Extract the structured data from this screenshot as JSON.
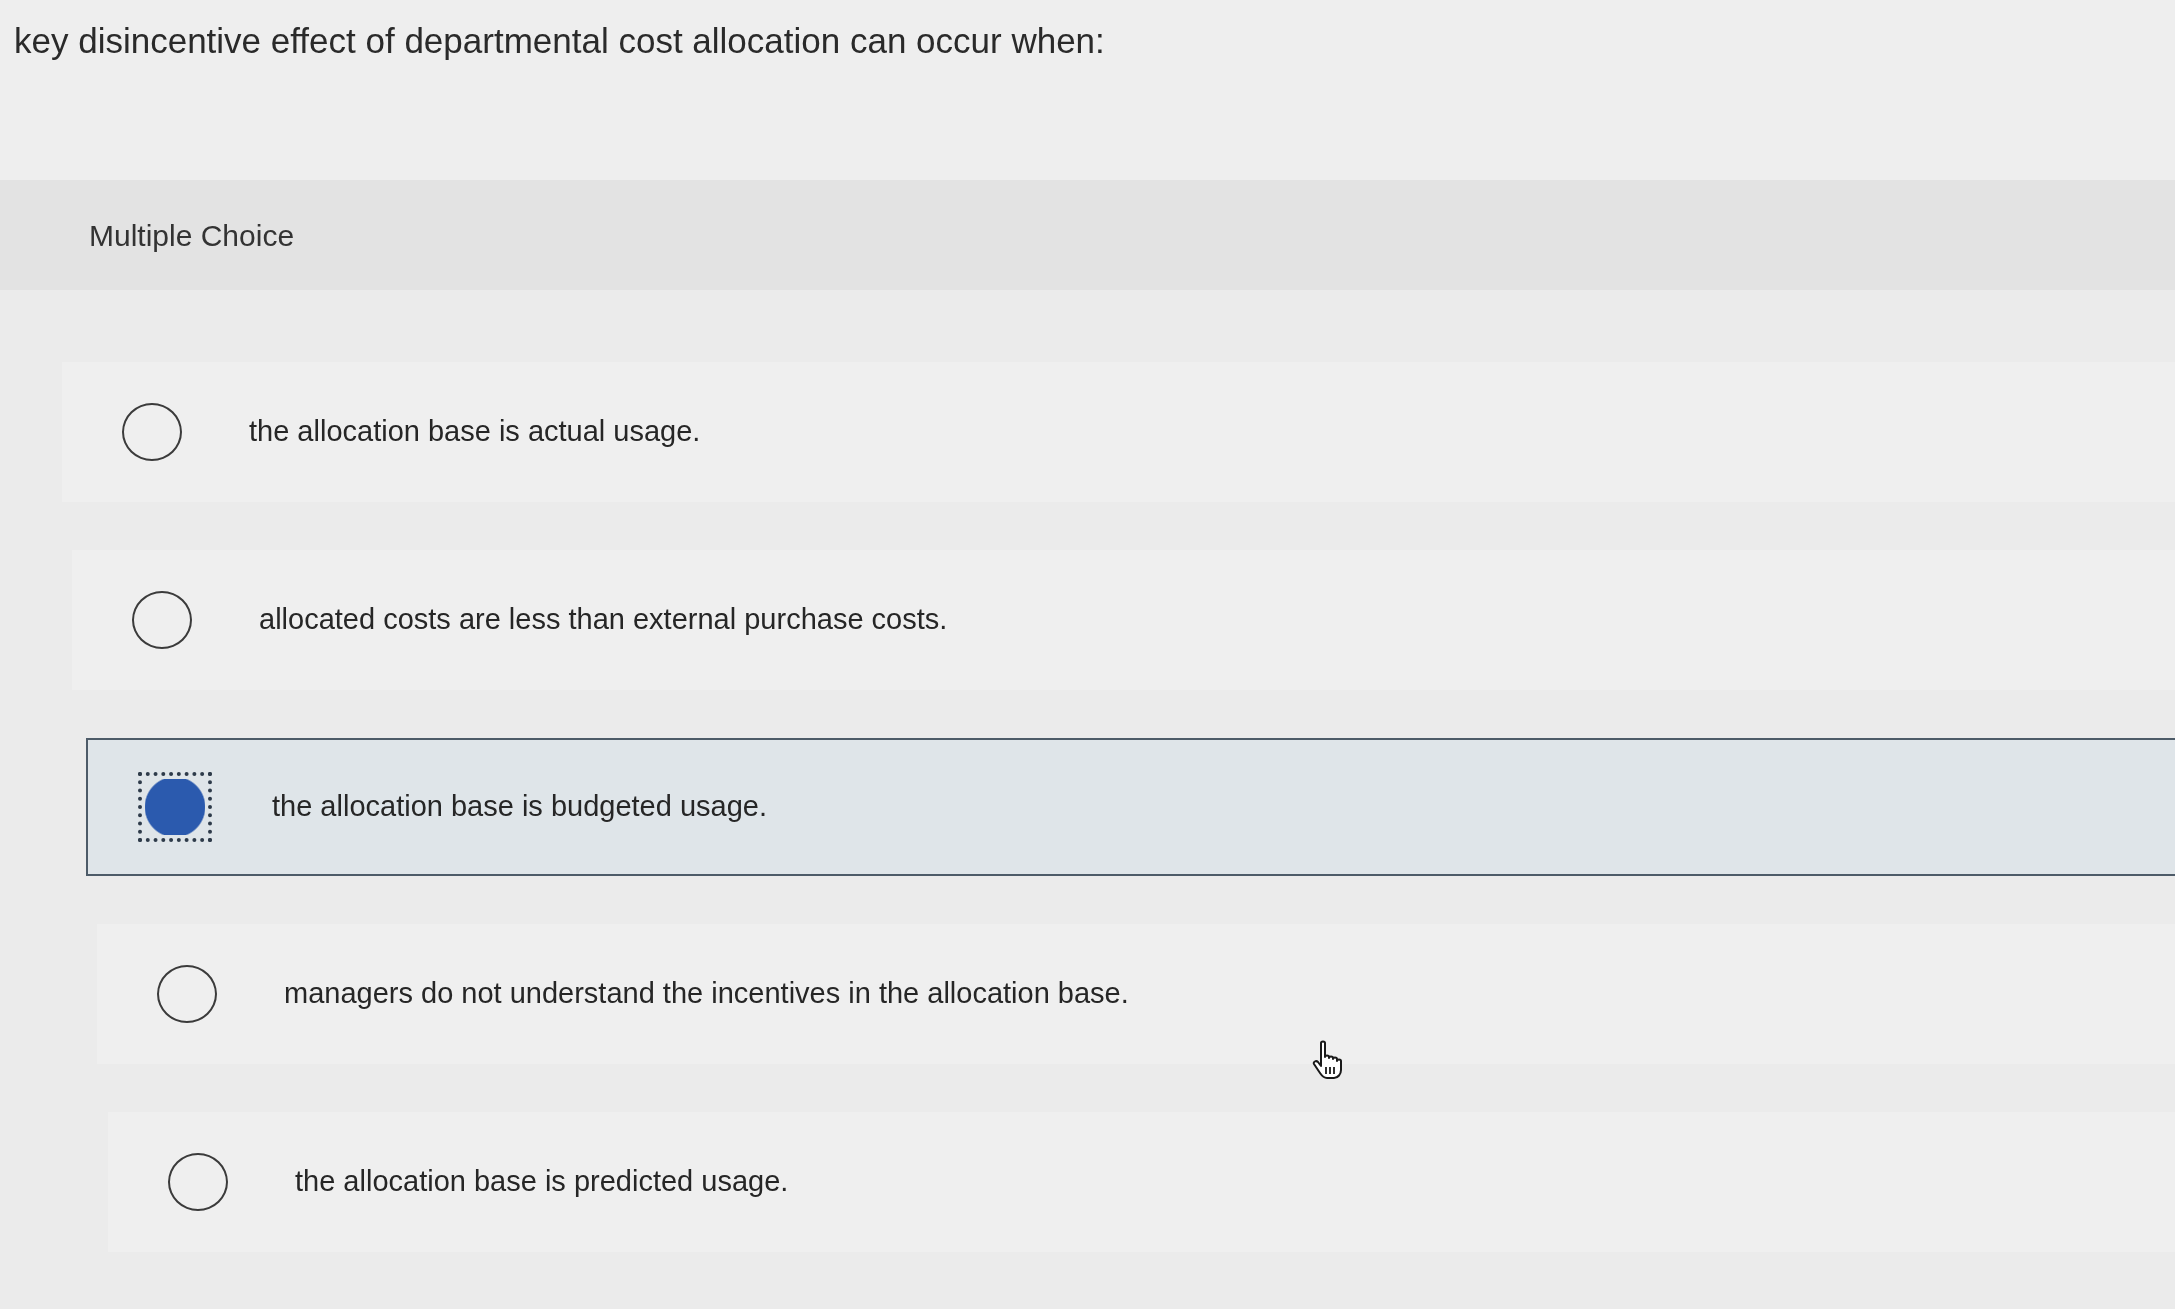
{
  "question": {
    "text": "key disincentive effect of departmental cost allocation can occur when:"
  },
  "section": {
    "label": "Multiple Choice"
  },
  "options": [
    {
      "label": "the allocation base is actual usage.",
      "selected": false
    },
    {
      "label": "allocated costs are less than external purchase costs.",
      "selected": false
    },
    {
      "label": "the allocation base is budgeted usage.",
      "selected": true
    },
    {
      "label": "managers do not understand the incentives in the allocation base.",
      "selected": false
    },
    {
      "label": "the allocation base is predicted usage.",
      "selected": false
    }
  ]
}
